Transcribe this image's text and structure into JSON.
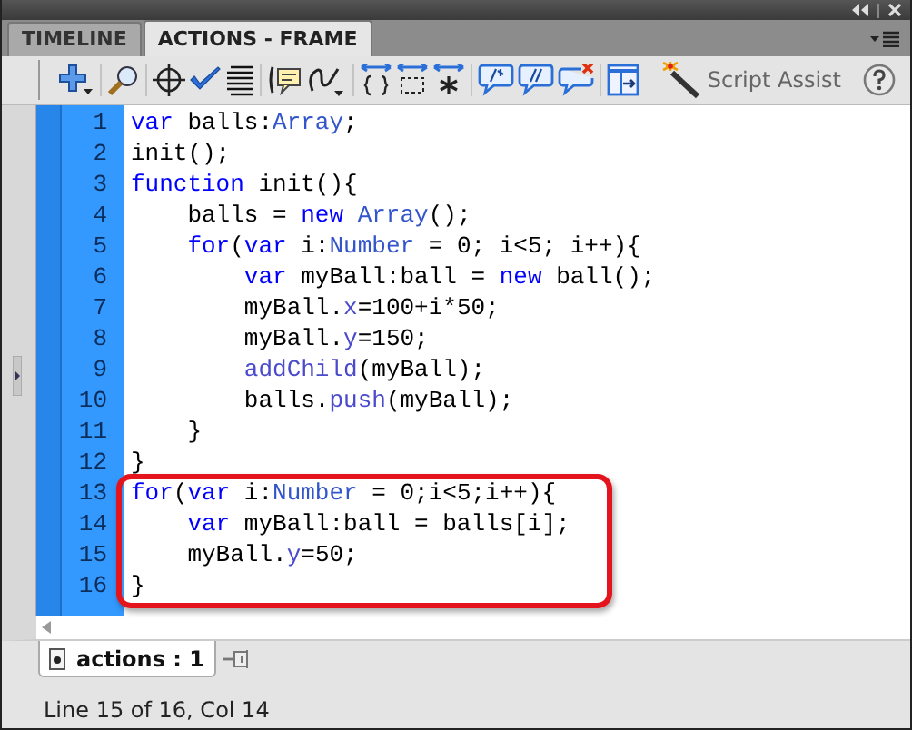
{
  "panel_tabs": [
    {
      "label": "TIMELINE",
      "selected": false
    },
    {
      "label": "ACTIONS - FRAME",
      "selected": true
    }
  ],
  "toolbar": {
    "script_assist": "Script Assist"
  },
  "code": [
    {
      "number": "1",
      "highlighted": false,
      "tokens": [
        {
          "kind": "keyword",
          "text": "var"
        },
        {
          "kind": "plain",
          "text": " balls:"
        },
        {
          "kind": "type",
          "text": "Array"
        },
        {
          "kind": "plain",
          "text": ";"
        }
      ]
    },
    {
      "number": "2",
      "highlighted": false,
      "tokens": [
        {
          "kind": "plain",
          "text": "init();"
        }
      ]
    },
    {
      "number": "3",
      "highlighted": false,
      "tokens": [
        {
          "kind": "keyword",
          "text": "function"
        },
        {
          "kind": "plain",
          "text": " init(){"
        }
      ]
    },
    {
      "number": "4",
      "highlighted": false,
      "tokens": [
        {
          "kind": "plain",
          "text": "    balls = "
        },
        {
          "kind": "keyword",
          "text": "new"
        },
        {
          "kind": "type",
          "text": " Array"
        },
        {
          "kind": "plain",
          "text": "();"
        }
      ]
    },
    {
      "number": "5",
      "highlighted": false,
      "tokens": [
        {
          "kind": "keyword",
          "text": "    for"
        },
        {
          "kind": "plain",
          "text": "("
        },
        {
          "kind": "keyword",
          "text": "var"
        },
        {
          "kind": "plain",
          "text": " i:"
        },
        {
          "kind": "type",
          "text": "Number"
        },
        {
          "kind": "plain",
          "text": " = 0; i<5; i++){"
        }
      ]
    },
    {
      "number": "6",
      "highlighted": false,
      "tokens": [
        {
          "kind": "keyword",
          "text": "        var"
        },
        {
          "kind": "plain",
          "text": " myBall:ball = "
        },
        {
          "kind": "keyword",
          "text": "new"
        },
        {
          "kind": "plain",
          "text": " ball();"
        }
      ]
    },
    {
      "number": "7",
      "highlighted": false,
      "tokens": [
        {
          "kind": "plain",
          "text": "        myBall."
        },
        {
          "kind": "member",
          "text": "x"
        },
        {
          "kind": "plain",
          "text": "=100+i*50;"
        }
      ]
    },
    {
      "number": "8",
      "highlighted": false,
      "tokens": [
        {
          "kind": "plain",
          "text": "        myBall."
        },
        {
          "kind": "member",
          "text": "y"
        },
        {
          "kind": "plain",
          "text": "=150;"
        }
      ]
    },
    {
      "number": "9",
      "highlighted": false,
      "tokens": [
        {
          "kind": "member",
          "text": "        addChild"
        },
        {
          "kind": "plain",
          "text": "(myBall);"
        }
      ]
    },
    {
      "number": "10",
      "highlighted": false,
      "tokens": [
        {
          "kind": "plain",
          "text": "        balls."
        },
        {
          "kind": "member",
          "text": "push"
        },
        {
          "kind": "plain",
          "text": "(myBall);"
        }
      ]
    },
    {
      "number": "11",
      "highlighted": false,
      "tokens": [
        {
          "kind": "plain",
          "text": "    }"
        }
      ]
    },
    {
      "number": "12",
      "highlighted": false,
      "tokens": [
        {
          "kind": "plain",
          "text": "}"
        }
      ]
    },
    {
      "number": "13",
      "highlighted": true,
      "tokens": [
        {
          "kind": "keyword",
          "text": "for"
        },
        {
          "kind": "plain",
          "text": "("
        },
        {
          "kind": "keyword",
          "text": "var"
        },
        {
          "kind": "plain",
          "text": " i:"
        },
        {
          "kind": "type",
          "text": "Number"
        },
        {
          "kind": "plain",
          "text": " = 0;i<5;i++){"
        }
      ]
    },
    {
      "number": "14",
      "highlighted": true,
      "tokens": [
        {
          "kind": "keyword",
          "text": "    var"
        },
        {
          "kind": "plain",
          "text": " myBall:ball = balls[i];"
        }
      ]
    },
    {
      "number": "15",
      "highlighted": true,
      "tokens": [
        {
          "kind": "plain",
          "text": "    myBall."
        },
        {
          "kind": "member",
          "text": "y"
        },
        {
          "kind": "plain",
          "text": "=50;"
        }
      ]
    },
    {
      "number": "16",
      "highlighted": true,
      "tokens": [
        {
          "kind": "plain",
          "text": "}"
        }
      ]
    }
  ],
  "file_tabs": [
    {
      "label": "actions : 1",
      "selected": true
    }
  ],
  "status_bar": "Line 15 of 16, Col 14"
}
